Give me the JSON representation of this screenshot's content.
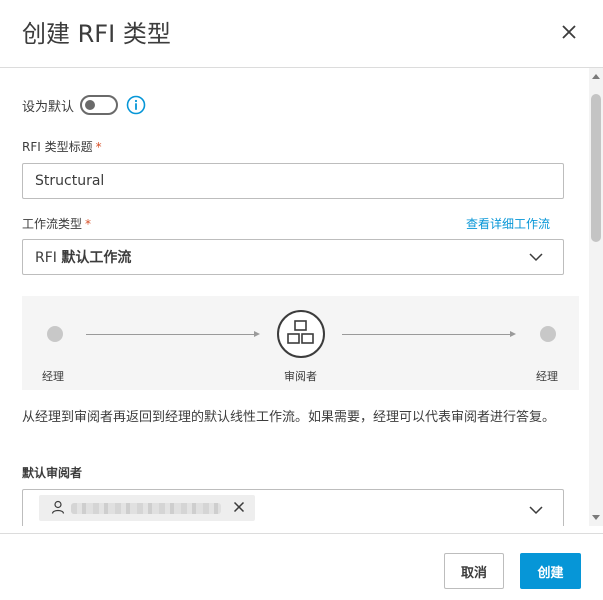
{
  "dialog": {
    "title": "创建 RFI 类型"
  },
  "default_toggle": {
    "label": "设为默认",
    "state": "off"
  },
  "rfi_type_title": {
    "label": "RFI 类型标题",
    "required_mark": "*",
    "value": "Structural"
  },
  "workflow_type": {
    "label": "工作流类型",
    "required_mark": "*",
    "view_details_link": "查看详细工作流",
    "selected_prefix": "RFI",
    "selected_bold": "默认工作流"
  },
  "workflow_diagram": {
    "start_label": "经理",
    "center_label": "审阅者",
    "end_label": "经理"
  },
  "description": "从经理到审阅者再返回到经理的默认线性工作流。如果需要，经理可以代表审阅者进行答复。",
  "default_reviewer": {
    "label": "默认审阅者"
  },
  "footer": {
    "cancel_label": "取消",
    "create_label": "创建"
  },
  "colors": {
    "accent": "#0696d7",
    "required": "#d74e26"
  },
  "icons": {
    "close": "close-icon",
    "info": "info-icon",
    "chevron": "chevron-down-icon",
    "workflow_center": "org-chart-icon",
    "person": "person-icon",
    "remove": "remove-icon"
  }
}
